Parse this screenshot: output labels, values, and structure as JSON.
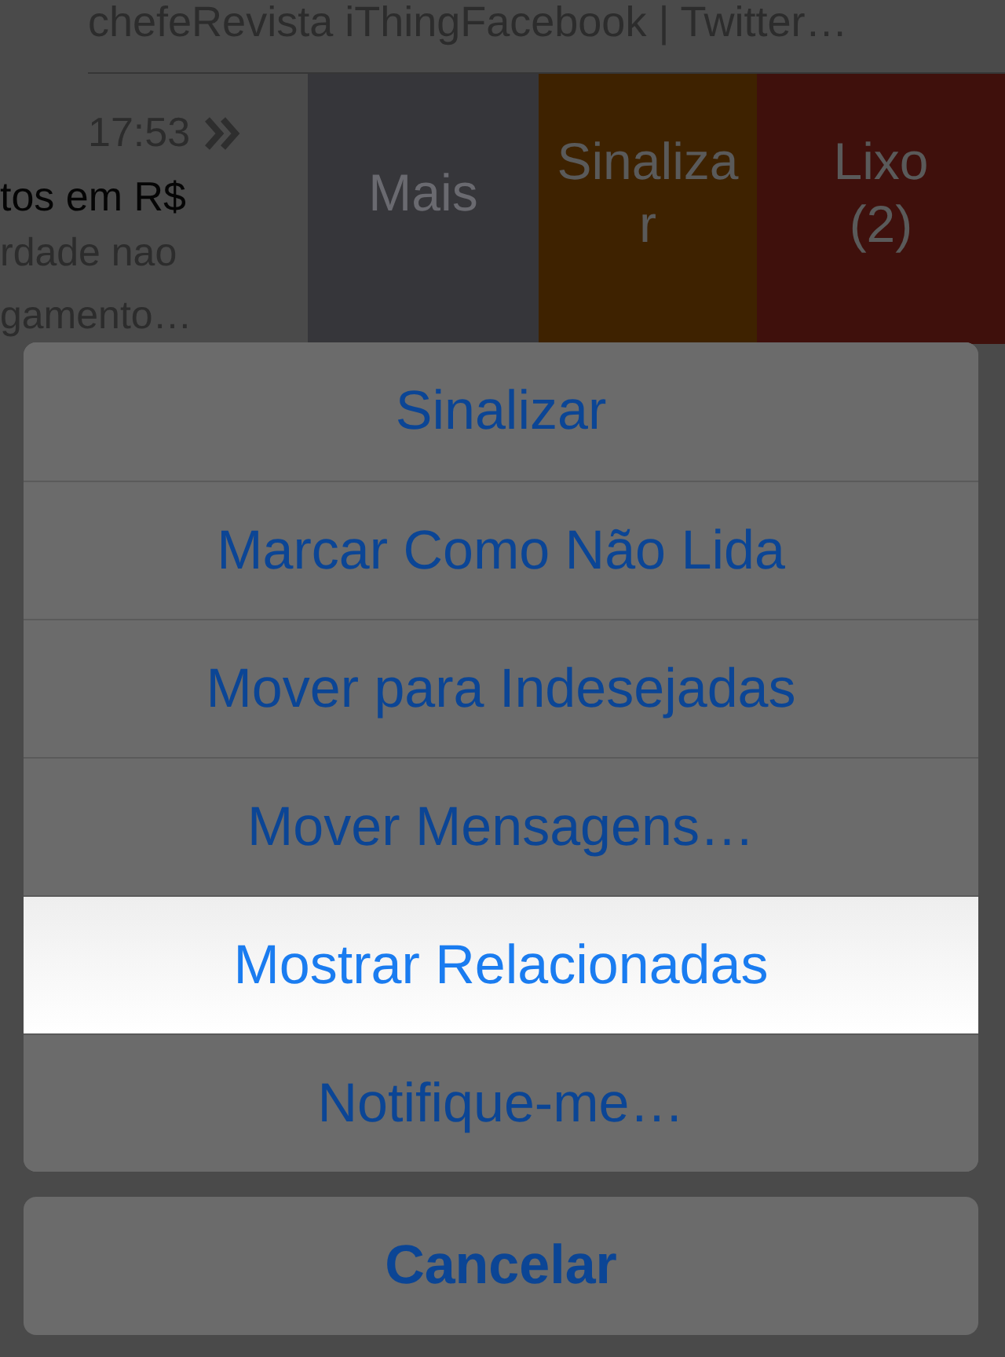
{
  "background": {
    "header_text": "chefeRevista iThingFacebook | Twitter…",
    "message": {
      "time": "17:53",
      "subject": "tos em R$",
      "preview_lines": [
        "rdade nao",
        "gamento…"
      ]
    },
    "swipe_actions": [
      {
        "kind": "more",
        "label_lines": [
          "Mais"
        ]
      },
      {
        "kind": "flag",
        "label_lines": [
          "Sinaliza",
          "r"
        ]
      },
      {
        "kind": "trash",
        "label_lines": [
          "Lixo",
          "(2)"
        ]
      }
    ]
  },
  "action_sheet": {
    "items": [
      {
        "label": "Sinalizar",
        "selected": false
      },
      {
        "label": "Marcar Como Não Lida",
        "selected": false
      },
      {
        "label": "Mover para Indesejadas",
        "selected": false
      },
      {
        "label": "Mover Mensagens…",
        "selected": false
      },
      {
        "label": "Mostrar Relacionadas",
        "selected": true
      },
      {
        "label": "Notifique-me…",
        "selected": false
      }
    ],
    "cancel": "Cancelar"
  }
}
